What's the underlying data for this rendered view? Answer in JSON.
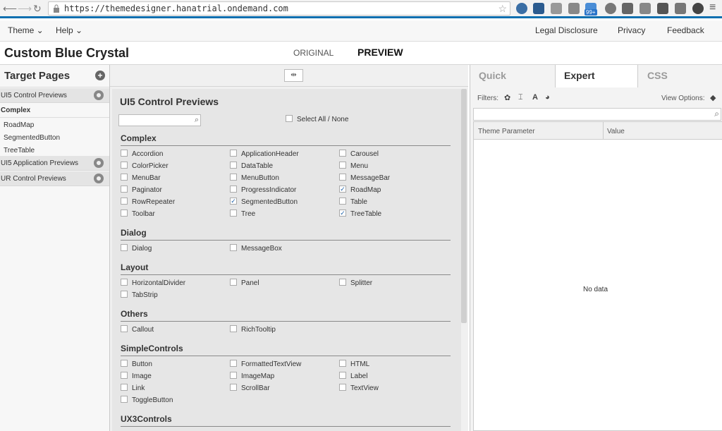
{
  "browser": {
    "url": "https://themedesigner.hanatrial.ondemand.com",
    "badge": "99+"
  },
  "menu": {
    "theme": "Theme ⌄",
    "help": "Help ⌄",
    "legal": "Legal Disclosure",
    "privacy": "Privacy",
    "feedback": "Feedback"
  },
  "header": {
    "title": "Custom Blue Crystal",
    "original": "ORIGINAL",
    "preview": "PREVIEW"
  },
  "left": {
    "title": "Target Pages",
    "rows": [
      {
        "label": "UI5 Control Previews",
        "kind": "cat"
      },
      {
        "label": "Complex",
        "kind": "sel"
      },
      {
        "label": "RoadMap",
        "kind": "sub"
      },
      {
        "label": "SegmentedButton",
        "kind": "sub"
      },
      {
        "label": "TreeTable",
        "kind": "sub"
      },
      {
        "label": "UI5 Application Previews",
        "kind": "cat"
      },
      {
        "label": "UR Control Previews",
        "kind": "cat"
      }
    ]
  },
  "center": {
    "title": "UI5 Control Previews",
    "select_all": "Select All / None",
    "sections": [
      {
        "name": "Complex",
        "items": [
          [
            "Accordion",
            false
          ],
          [
            "ApplicationHeader",
            false
          ],
          [
            "Carousel",
            false
          ],
          [
            "ColorPicker",
            false
          ],
          [
            "DataTable",
            false
          ],
          [
            "Menu",
            false
          ],
          [
            "MenuBar",
            false
          ],
          [
            "MenuButton",
            false
          ],
          [
            "MessageBar",
            false
          ],
          [
            "Paginator",
            false
          ],
          [
            "ProgressIndicator",
            false
          ],
          [
            "RoadMap",
            true
          ],
          [
            "RowRepeater",
            false
          ],
          [
            "SegmentedButton",
            true
          ],
          [
            "Table",
            false
          ],
          [
            "Toolbar",
            false
          ],
          [
            "Tree",
            false
          ],
          [
            "TreeTable",
            true
          ]
        ]
      },
      {
        "name": "Dialog",
        "items": [
          [
            "Dialog",
            false
          ],
          [
            "MessageBox",
            false
          ]
        ]
      },
      {
        "name": "Layout",
        "items": [
          [
            "HorizontalDivider",
            false
          ],
          [
            "Panel",
            false
          ],
          [
            "Splitter",
            false
          ],
          [
            "TabStrip",
            false
          ]
        ]
      },
      {
        "name": "Others",
        "items": [
          [
            "Callout",
            false
          ],
          [
            "RichTooltip",
            false
          ]
        ]
      },
      {
        "name": "SimpleControls",
        "items": [
          [
            "Button",
            false
          ],
          [
            "FormattedTextView",
            false
          ],
          [
            "HTML",
            false
          ],
          [
            "Image",
            false
          ],
          [
            "ImageMap",
            false
          ],
          [
            "Label",
            false
          ],
          [
            "Link",
            false
          ],
          [
            "ScrollBar",
            false
          ],
          [
            "TextView",
            false
          ],
          [
            "ToggleButton",
            false
          ]
        ]
      },
      {
        "name": "UX3Controls",
        "items": []
      }
    ]
  },
  "right": {
    "tabs": [
      "Quick",
      "Expert",
      "CSS"
    ],
    "active_tab": "Expert",
    "filters": "Filters:",
    "view_options": "View Options:",
    "col1": "Theme Parameter",
    "col2": "Value",
    "nodata": "No data"
  },
  "colors": {
    "accent": "#0b6fb0",
    "check": "#1a5fa8"
  }
}
